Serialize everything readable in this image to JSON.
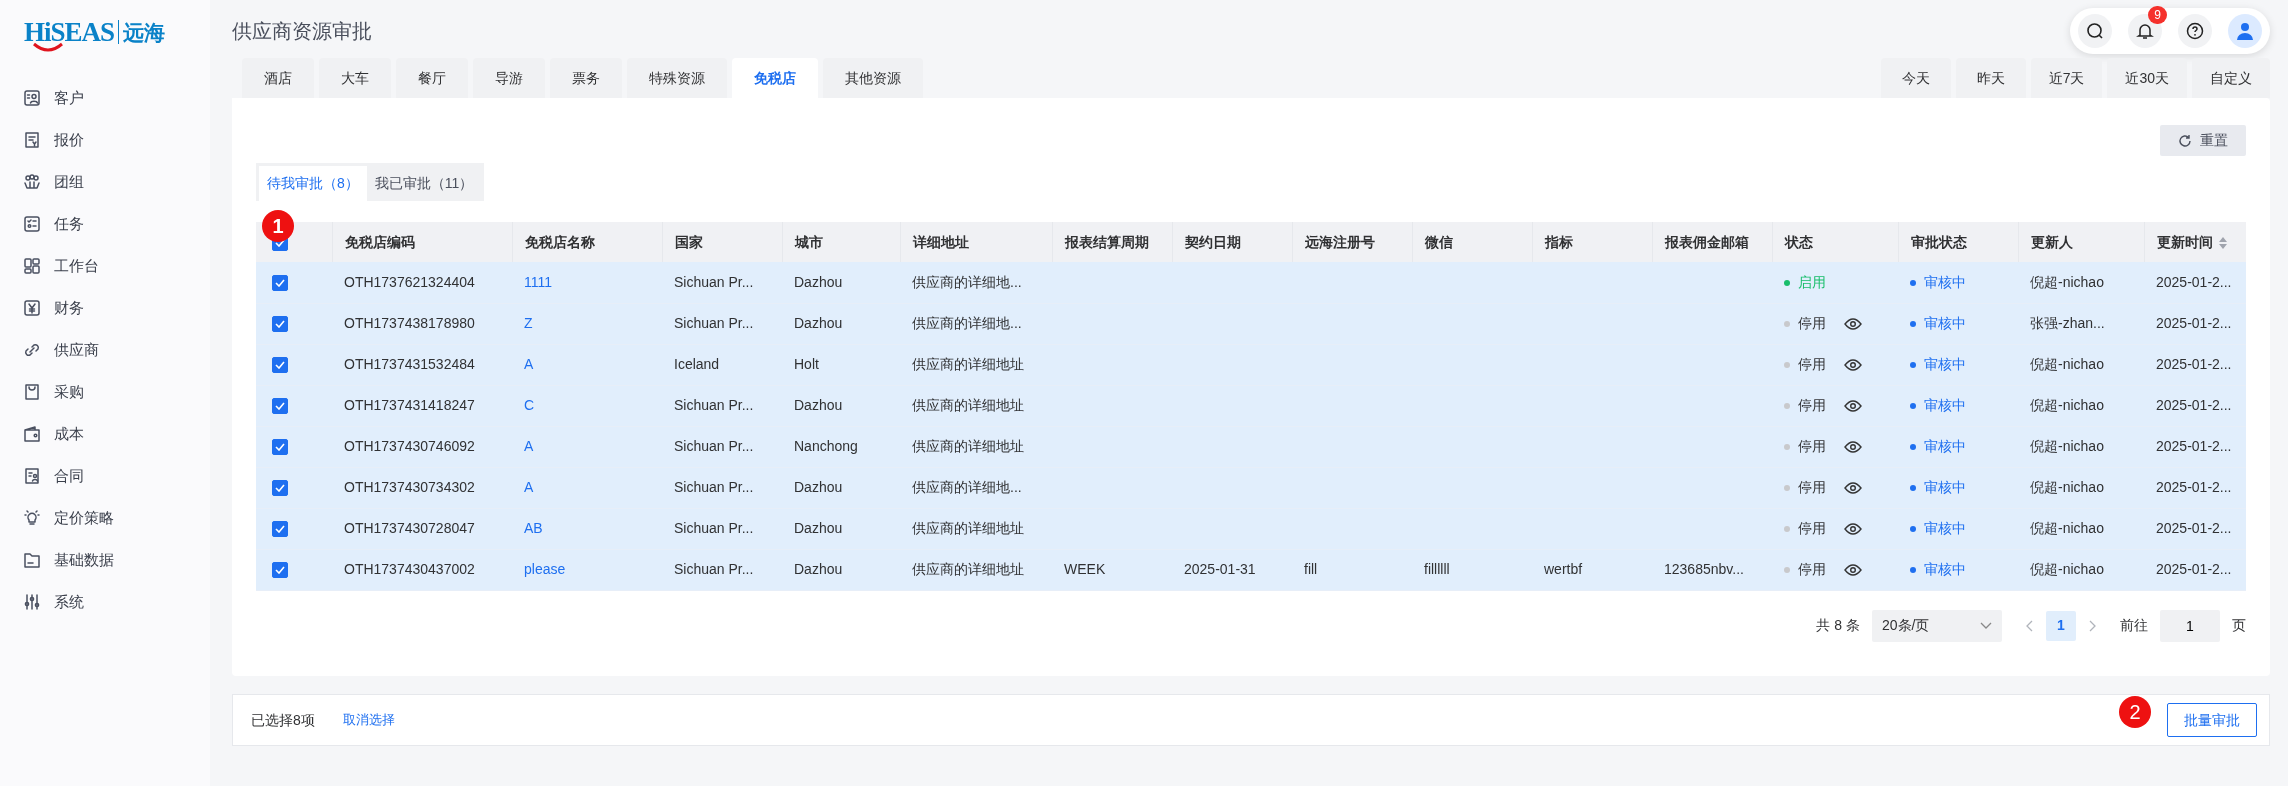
{
  "sidebar": {
    "logo": {
      "brand": "HiSEAS",
      "name": "远海"
    },
    "items": [
      {
        "label": "客户"
      },
      {
        "label": "报价"
      },
      {
        "label": "团组"
      },
      {
        "label": "任务"
      },
      {
        "label": "工作台"
      },
      {
        "label": "财务"
      },
      {
        "label": "供应商"
      },
      {
        "label": "采购"
      },
      {
        "label": "成本"
      },
      {
        "label": "合同"
      },
      {
        "label": "定价策略"
      },
      {
        "label": "基础数据"
      },
      {
        "label": "系统"
      }
    ]
  },
  "page_title": "供应商资源审批",
  "header_actions": {
    "notification_count": "9"
  },
  "resource_tabs": [
    {
      "label": "酒店",
      "selected": false
    },
    {
      "label": "大车",
      "selected": false
    },
    {
      "label": "餐厅",
      "selected": false
    },
    {
      "label": "导游",
      "selected": false
    },
    {
      "label": "票务",
      "selected": false
    },
    {
      "label": "特殊资源",
      "selected": false
    },
    {
      "label": "免税店",
      "selected": true
    },
    {
      "label": "其他资源",
      "selected": false
    }
  ],
  "date_tabs": [
    {
      "label": "今天",
      "selected": false
    },
    {
      "label": "昨天",
      "selected": false
    },
    {
      "label": "近7天",
      "selected": false
    },
    {
      "label": "近30天",
      "selected": false
    },
    {
      "label": "自定义",
      "selected": false
    }
  ],
  "reset_button": "重置",
  "approval_tabs": [
    {
      "label": "待我审批（8）",
      "selected": true
    },
    {
      "label": "我已审批（11）",
      "selected": false
    }
  ],
  "table": {
    "select_all_checked": true,
    "columns": [
      {
        "label": "免税店编码",
        "sortable": false
      },
      {
        "label": "免税店名称",
        "sortable": false
      },
      {
        "label": "国家",
        "sortable": false
      },
      {
        "label": "城市",
        "sortable": false
      },
      {
        "label": "详细地址",
        "sortable": false
      },
      {
        "label": "报表结算周期",
        "sortable": false
      },
      {
        "label": "契约日期",
        "sortable": false
      },
      {
        "label": "远海注册号",
        "sortable": false
      },
      {
        "label": "微信",
        "sortable": false
      },
      {
        "label": "指标",
        "sortable": false
      },
      {
        "label": "报表佣金邮箱",
        "sortable": false
      },
      {
        "label": "状态",
        "sortable": false
      },
      {
        "label": "审批状态",
        "sortable": false
      },
      {
        "label": "更新人",
        "sortable": false
      },
      {
        "label": "更新时间",
        "sortable": true
      }
    ],
    "rows": [
      {
        "checked": true,
        "code": "OTH1737621324404",
        "name": "1111",
        "country": "Sichuan Pr...",
        "city": "Dazhou",
        "address": "供应商的详细地...",
        "period": "",
        "date": "",
        "reg": "",
        "wechat": "",
        "index": "",
        "email": "",
        "status": {
          "label": "启用",
          "enabled": true
        },
        "approval": "审核中",
        "updater": "倪超-nichao",
        "updated": "2025-01-2..."
      },
      {
        "checked": true,
        "code": "OTH1737438178980",
        "name": "Z",
        "country": "Sichuan Pr...",
        "city": "Dazhou",
        "address": "供应商的详细地...",
        "period": "",
        "date": "",
        "reg": "",
        "wechat": "",
        "index": "",
        "email": "",
        "status": {
          "label": "停用",
          "enabled": false
        },
        "approval": "审核中",
        "updater": "张强-zhan...",
        "updated": "2025-01-2..."
      },
      {
        "checked": true,
        "code": "OTH1737431532484",
        "name": "A",
        "country": "Iceland",
        "city": "Holt",
        "address": "供应商的详细地址",
        "period": "",
        "date": "",
        "reg": "",
        "wechat": "",
        "index": "",
        "email": "",
        "status": {
          "label": "停用",
          "enabled": false
        },
        "approval": "审核中",
        "updater": "倪超-nichao",
        "updated": "2025-01-2..."
      },
      {
        "checked": true,
        "code": "OTH1737431418247",
        "name": "C",
        "country": "Sichuan Pr...",
        "city": "Dazhou",
        "address": "供应商的详细地址",
        "period": "",
        "date": "",
        "reg": "",
        "wechat": "",
        "index": "",
        "email": "",
        "status": {
          "label": "停用",
          "enabled": false
        },
        "approval": "审核中",
        "updater": "倪超-nichao",
        "updated": "2025-01-2..."
      },
      {
        "checked": true,
        "code": "OTH1737430746092",
        "name": "A",
        "country": "Sichuan Pr...",
        "city": "Nanchong",
        "address": "供应商的详细地址",
        "period": "",
        "date": "",
        "reg": "",
        "wechat": "",
        "index": "",
        "email": "",
        "status": {
          "label": "停用",
          "enabled": false
        },
        "approval": "审核中",
        "updater": "倪超-nichao",
        "updated": "2025-01-2..."
      },
      {
        "checked": true,
        "code": "OTH1737430734302",
        "name": "A",
        "country": "Sichuan Pr...",
        "city": "Dazhou",
        "address": "供应商的详细地...",
        "period": "",
        "date": "",
        "reg": "",
        "wechat": "",
        "index": "",
        "email": "",
        "status": {
          "label": "停用",
          "enabled": false
        },
        "approval": "审核中",
        "updater": "倪超-nichao",
        "updated": "2025-01-2..."
      },
      {
        "checked": true,
        "code": "OTH1737430728047",
        "name": "AB",
        "country": "Sichuan Pr...",
        "city": "Dazhou",
        "address": "供应商的详细地址",
        "period": "",
        "date": "",
        "reg": "",
        "wechat": "",
        "index": "",
        "email": "",
        "status": {
          "label": "停用",
          "enabled": false
        },
        "approval": "审核中",
        "updater": "倪超-nichao",
        "updated": "2025-01-2..."
      },
      {
        "checked": true,
        "code": "OTH1737430437002",
        "name": "please",
        "country": "Sichuan Pr...",
        "city": "Dazhou",
        "address": "供应商的详细地址",
        "period": "WEEK",
        "date": "2025-01-31",
        "reg": "fill",
        "wechat": "fillllll",
        "index": "wertbf",
        "email": "123685nbv...",
        "status": {
          "label": "停用",
          "enabled": false
        },
        "approval": "审核中",
        "updater": "倪超-nichao",
        "updated": "2025-01-2..."
      }
    ]
  },
  "pagination": {
    "total": "共 8 条",
    "page_size": "20条/页",
    "pages": [
      {
        "label": "1",
        "selected": true
      }
    ],
    "goto_label": "前往",
    "goto_value": "1",
    "page_unit": "页"
  },
  "selection_bar": {
    "text": "已选择8项",
    "clear_link": "取消选择",
    "batch_button": "批量审批"
  },
  "annotations": [
    {
      "label": "1"
    },
    {
      "label": "2"
    }
  ]
}
